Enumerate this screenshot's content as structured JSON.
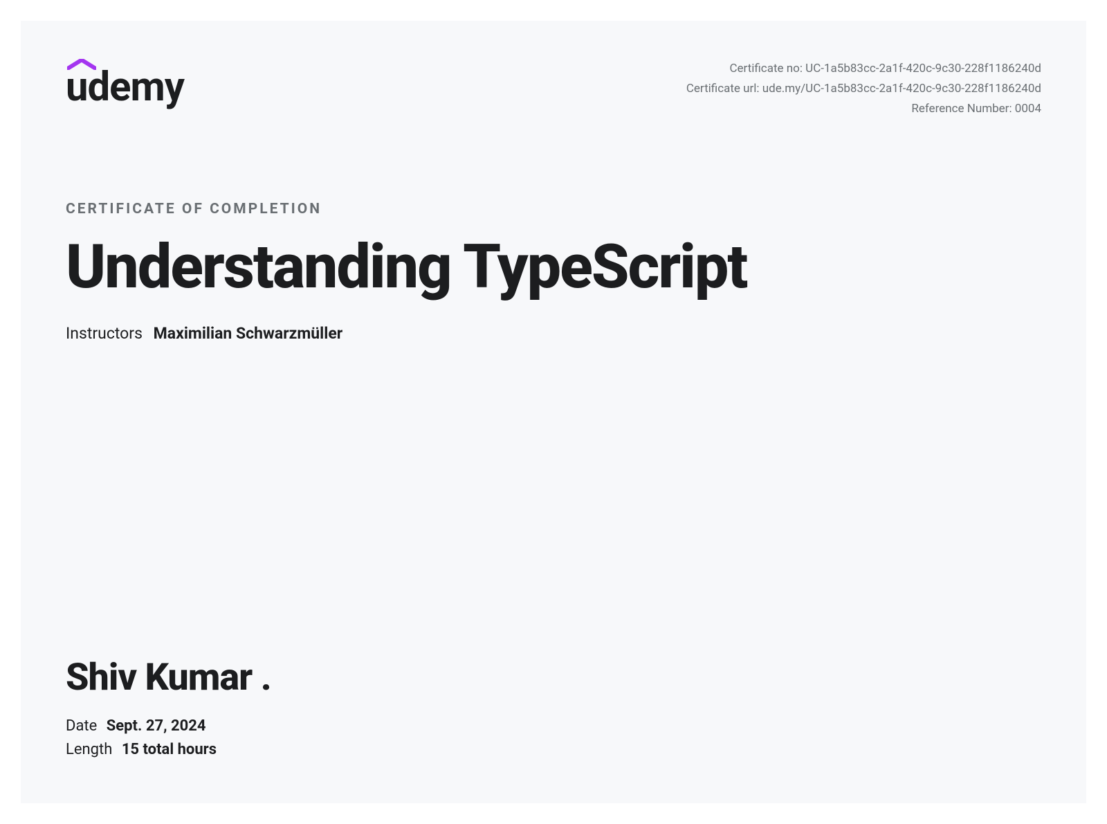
{
  "brand": {
    "name": "udemy",
    "accent_color": "#a435f0"
  },
  "meta": {
    "cert_no_label": "Certificate no: ",
    "cert_no_value": "UC-1a5b83cc-2a1f-420c-9c30-228f1186240d",
    "cert_url_label": "Certificate url: ",
    "cert_url_value": "ude.my/UC-1a5b83cc-2a1f-420c-9c30-228f1186240d",
    "ref_label": "Reference Number: ",
    "ref_value": "0004"
  },
  "heading": "Certificate of Completion",
  "course_title": "Understanding TypeScript",
  "instructors": {
    "label": "Instructors",
    "value": "Maximilian Schwarzmüller"
  },
  "recipient": "Shiv Kumar .",
  "date": {
    "label": "Date",
    "value": "Sept. 27, 2024"
  },
  "length": {
    "label": "Length",
    "value": "15 total hours"
  }
}
